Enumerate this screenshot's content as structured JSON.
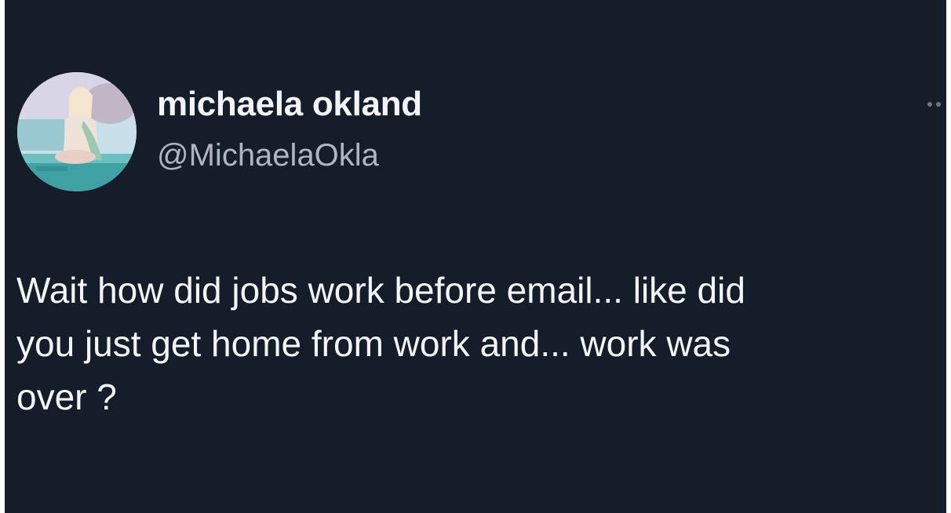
{
  "tweet": {
    "display_name": "michaela okland",
    "handle": "@MichaelaOkla",
    "text_lines": [
      "Wait how did jobs work before email... like did",
      "you just get home from work and... work was",
      "over ?"
    ]
  },
  "icons": {
    "more": "more-options-icon",
    "avatar": "profile-avatar"
  },
  "colors": {
    "background": "#151d2a",
    "name": "#f2f4f6",
    "handle": "#aeb6bf",
    "text": "#f3f5f7"
  }
}
